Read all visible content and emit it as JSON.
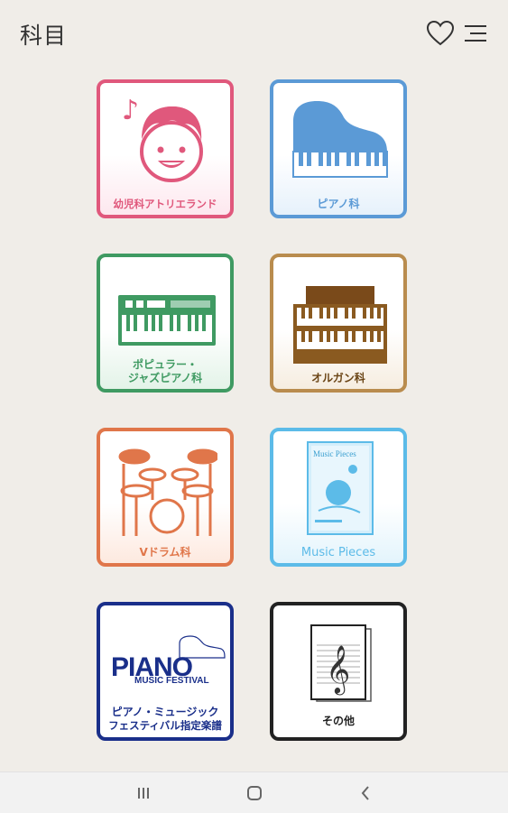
{
  "header": {
    "title": "科目"
  },
  "tiles": [
    {
      "label": "幼児科アトリエランド",
      "color": "#e0587c"
    },
    {
      "label": "ピアノ科",
      "color": "#5b9ad6"
    },
    {
      "label_line1": "ポピュラー・",
      "label_line2": "ジャズピアノ科",
      "color": "#3f9a62"
    },
    {
      "label": "オルガン科",
      "color": "#8a5a20"
    },
    {
      "label": "Vドラム科",
      "color": "#e0764a"
    },
    {
      "label": "Music Pieces",
      "color": "#5cbbe8",
      "cover_text": "Music Pieces"
    },
    {
      "logo_line1": "PIANO",
      "logo_line2": "MUSIC FESTIVAL",
      "label_line1": "ピアノ・ミュージック",
      "label_line2": "フェスティバル指定楽譜",
      "color": "#1a2f8a"
    },
    {
      "label": "その他",
      "color": "#222222"
    }
  ],
  "icons": {
    "favorite": "heart-icon",
    "menu": "menu-icon"
  },
  "navbar": {
    "recent": "recent-apps-icon",
    "home": "home-icon",
    "back": "back-icon"
  }
}
